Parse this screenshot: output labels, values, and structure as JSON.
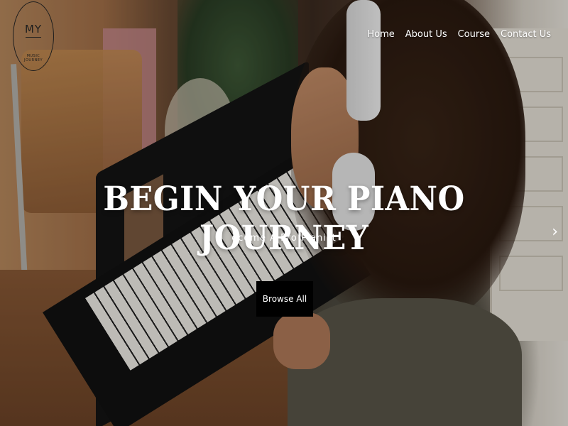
{
  "logo": {
    "text": "MY",
    "subtext": "MUSIC JOURNEY"
  },
  "nav": {
    "items": [
      "Home",
      "About Us",
      "Course",
      "Contact Us"
    ]
  },
  "hero": {
    "title": "BEGIN YOUR PIANO JOURNEY",
    "subtitle": "ecome A Pro Pianist",
    "button_label": "Browse All",
    "next_icon": "chevron-right-icon"
  }
}
